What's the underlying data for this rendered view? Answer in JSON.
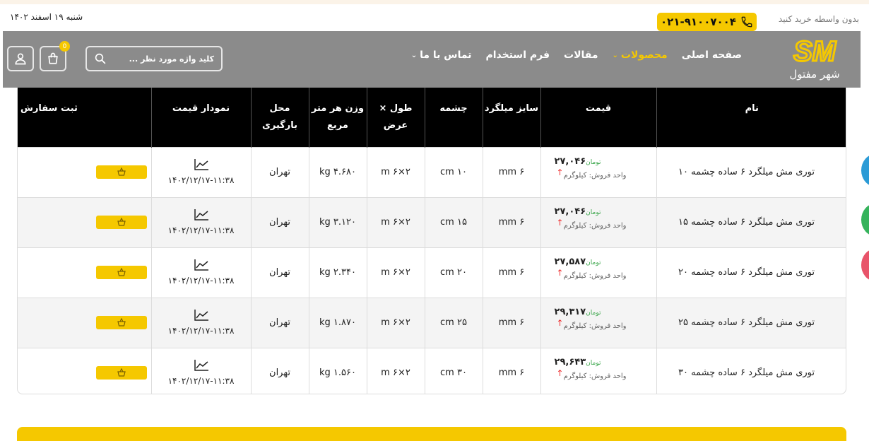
{
  "topbar": {
    "date": "شنبه ۱۹ اسفند ۱۴۰۲",
    "phone": "۰۲۱-۹۱۰۰۷۰۰۴",
    "buy_direct": "بدون واسطه خرید کنید"
  },
  "header": {
    "logo_text": "SM",
    "logo_subtitle": "شهر مفتول",
    "nav": [
      {
        "label": "صفحه اصلی",
        "active": false,
        "dropdown": false
      },
      {
        "label": "محصولات",
        "active": true,
        "dropdown": true
      },
      {
        "label": "مقالات",
        "active": false,
        "dropdown": false
      },
      {
        "label": "فرم استخدام",
        "active": false,
        "dropdown": false
      },
      {
        "label": "تماس با ما",
        "active": false,
        "dropdown": true
      }
    ],
    "search_placeholder": "کلید واژه مورد نظر ...",
    "cart_count": "0"
  },
  "table": {
    "headers": {
      "name": "نام",
      "price": "قیمت",
      "size": "سایز میلگرد",
      "mesh": "چشمه",
      "dims": "طول × عرض",
      "weight": "وزن هر متر مربع",
      "location": "محل بارگیری",
      "chart": "نمودار قیمت",
      "order": "ثبت سفارش"
    },
    "rows": [
      {
        "name": "توری مش میلگرد ۶ ساده چشمه ۱۰",
        "price": "۲۷,۰۴۶",
        "currency": "تومان",
        "unit": "واحد فروش: کیلوگرم",
        "size": "۶ mm",
        "mesh": "۱۰ cm",
        "dims": "۲×۶ m",
        "weight": "۴.۶۸۰ kg",
        "location": "تهران",
        "date": "۱۴۰۲/۱۲/۱۷-۱۱:۳۸"
      },
      {
        "name": "توری مش میلگرد ۶ ساده چشمه ۱۵",
        "price": "۲۷,۰۴۶",
        "currency": "تومان",
        "unit": "واحد فروش: کیلوگرم",
        "size": "۶ mm",
        "mesh": "۱۵ cm",
        "dims": "۲×۶ m",
        "weight": "۳.۱۲۰ kg",
        "location": "تهران",
        "date": "۱۴۰۲/۱۲/۱۷-۱۱:۳۸"
      },
      {
        "name": "توری مش میلگرد ۶ ساده چشمه ۲۰",
        "price": "۲۷,۵۸۷",
        "currency": "تومان",
        "unit": "واحد فروش: کیلوگرم",
        "size": "۶ mm",
        "mesh": "۲۰ cm",
        "dims": "۲×۶ m",
        "weight": "۲.۳۴۰ kg",
        "location": "تهران",
        "date": "۱۴۰۲/۱۲/۱۷-۱۱:۳۸"
      },
      {
        "name": "توری مش میلگرد ۶ ساده چشمه ۲۵",
        "price": "۲۹,۳۱۷",
        "currency": "تومان",
        "unit": "واحد فروش: کیلوگرم",
        "size": "۶ mm",
        "mesh": "۲۵ cm",
        "dims": "۲×۶ m",
        "weight": "۱.۸۷۰ kg",
        "location": "تهران",
        "date": "۱۴۰۲/۱۲/۱۷-۱۱:۳۸"
      },
      {
        "name": "توری مش میلگرد ۶ ساده چشمه ۳۰",
        "price": "۲۹,۶۴۳",
        "currency": "تومان",
        "unit": "واحد فروش: کیلوگرم",
        "size": "۶ mm",
        "mesh": "۳۰ cm",
        "dims": "۲×۶ m",
        "weight": "۱.۵۶۰ kg",
        "location": "تهران",
        "date": "۱۴۰۲/۱۲/۱۷-۱۱:۳۸"
      }
    ]
  },
  "colors": {
    "brand_yellow": "#f5c800",
    "header_gray": "#8b8b8b",
    "table_header": "#000000",
    "price_up": "#e33333",
    "currency_green": "#3aa64a"
  },
  "icons": {
    "phone": "phone-icon",
    "search": "search-icon",
    "cart": "cart-icon",
    "user": "user-icon",
    "chart": "line-chart-icon",
    "order": "basket-icon",
    "price_trend": "arrow-up-icon"
  }
}
